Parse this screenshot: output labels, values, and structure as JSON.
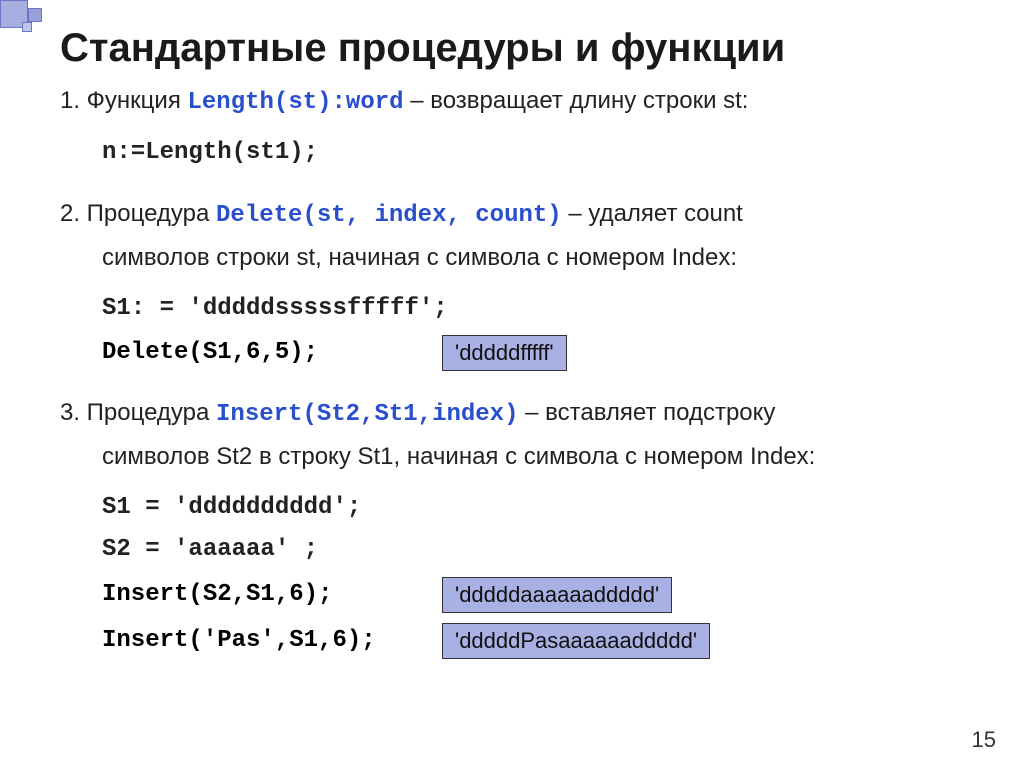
{
  "title": "Стандартные процедуры и функции",
  "item1": {
    "prefix": "1. Функция ",
    "code": "Length(st):word",
    "suffix": " – возвращает длину строки st:",
    "expr": "n:=Length(st1);"
  },
  "item2": {
    "prefix": "2. Процедура ",
    "code": "Delete(st, index, count)",
    "suffix": " – удаляет count",
    "line2": "символов строки st, начиная с символа с номером Index:",
    "expr1": "S1: = 'dddddsssssfffff';",
    "expr2": "Delete(S1,6,5);",
    "result": "'dddddfffff'"
  },
  "item3": {
    "prefix": "3. Процедура ",
    "code": "Insert(St2,St1,index)",
    "suffix": " – вставляет подстроку",
    "line2": "символов St2 в строку St1, начиная с символа с номером Index:",
    "expr1": "S1 = 'dddddddddd';",
    "expr2": "S2 = 'aaaaaa' ;",
    "expr3": "Insert(S2,S1,6);",
    "result1": "'dddddaaaaaaddddd'",
    "expr4": "Insert('Pas',S1,6);",
    "result2": "'dddddPasaaaaaaddddd'"
  },
  "pagenum": "15"
}
